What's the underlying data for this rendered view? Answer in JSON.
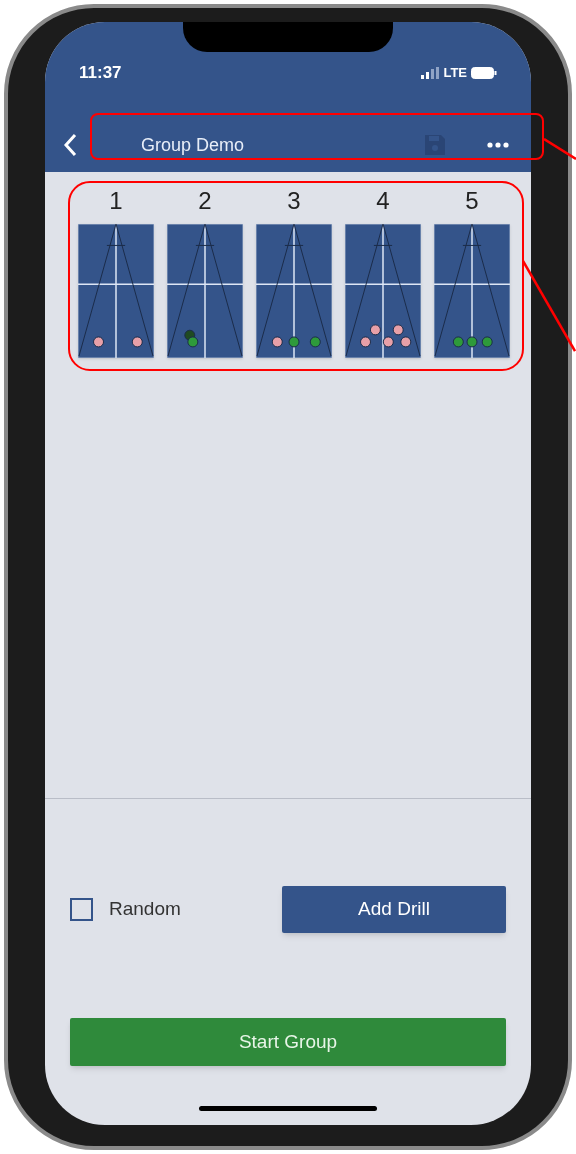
{
  "status_bar": {
    "time": "11:37",
    "network": "LTE"
  },
  "header": {
    "title": "Group Demo"
  },
  "drills": [
    {
      "label": "1",
      "balls": [
        {
          "color": "#e8a0a8"
        },
        {
          "color": "#e8a0a8"
        }
      ]
    },
    {
      "label": "2",
      "balls": [
        {
          "color": "#1f4a22"
        },
        {
          "color": "#2e9a3a"
        }
      ]
    },
    {
      "label": "3",
      "balls": [
        {
          "color": "#e8a0a8"
        },
        {
          "color": "#2e9a3a"
        },
        {
          "color": "#2e9a3a"
        }
      ]
    },
    {
      "label": "4",
      "balls": [
        {
          "color": "#e8a0a8"
        },
        {
          "color": "#e8a0a8"
        },
        {
          "color": "#e8a0a8"
        },
        {
          "color": "#e8a0a8"
        },
        {
          "color": "#e8a0a8"
        }
      ]
    },
    {
      "label": "5",
      "balls": [
        {
          "color": "#2e9a3a"
        },
        {
          "color": "#2e9a3a"
        },
        {
          "color": "#2e9a3a"
        }
      ]
    }
  ],
  "random": {
    "label": "Random",
    "checked": false
  },
  "buttons": {
    "add": "Add Drill",
    "start": "Start Group"
  }
}
